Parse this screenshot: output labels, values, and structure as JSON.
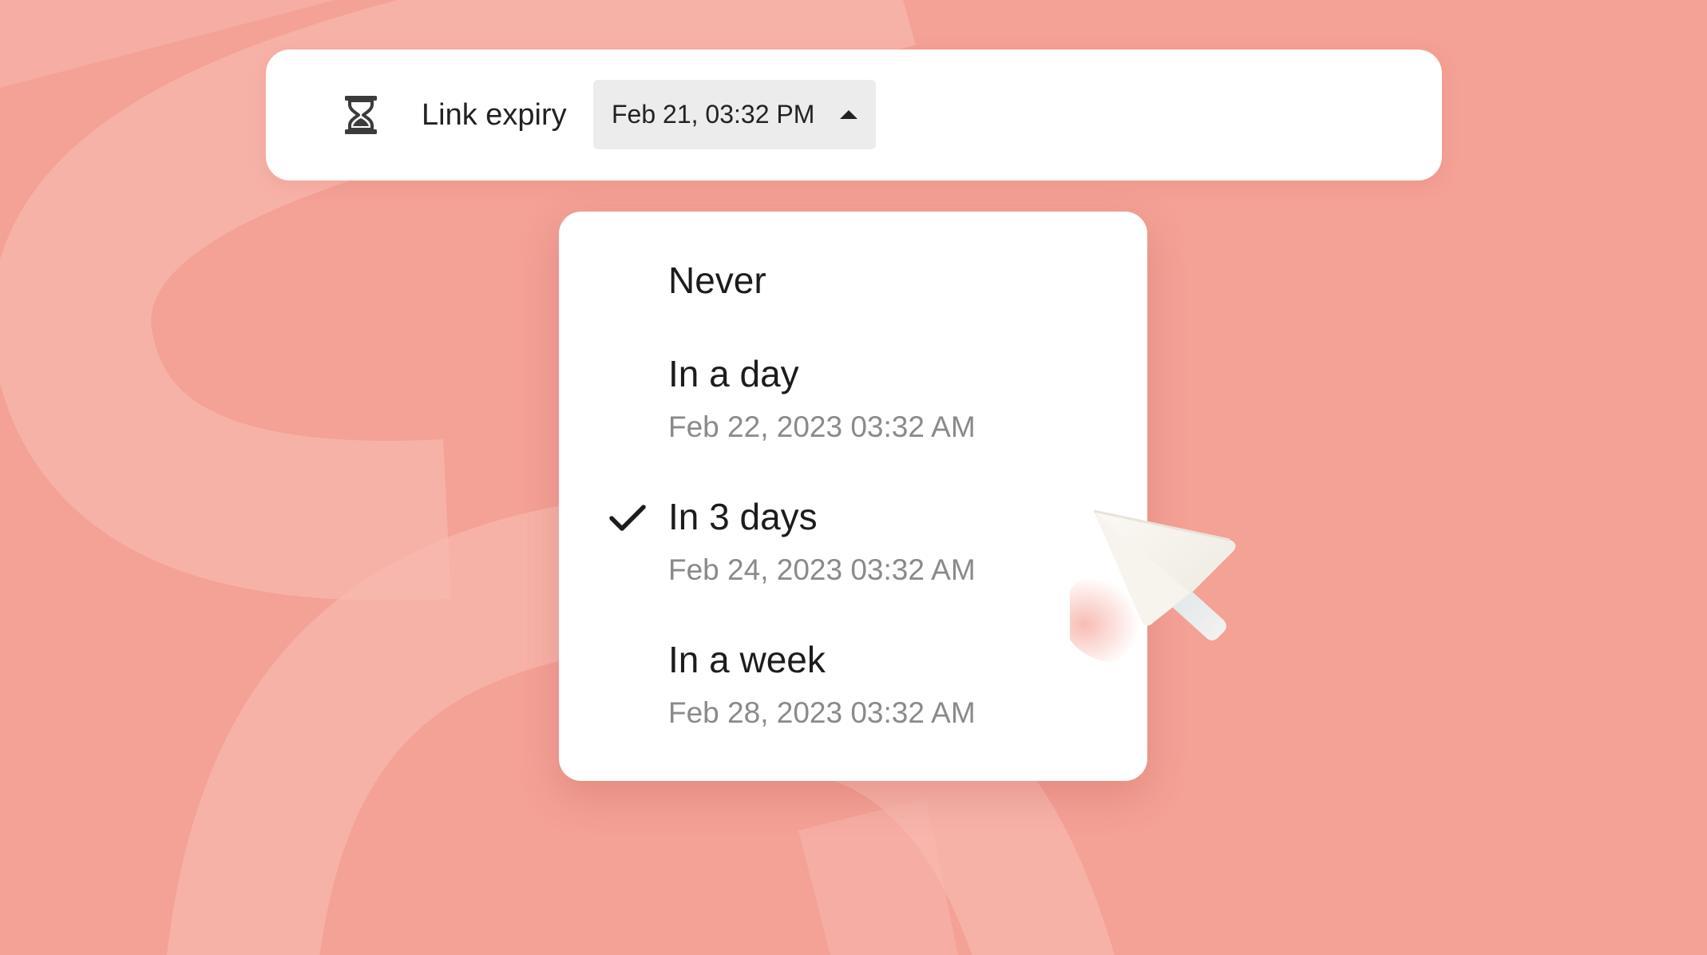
{
  "link_expiry": {
    "icon": "hourglass-icon",
    "label": "Link expiry",
    "selected_value": "Feb 21, 03:32 PM",
    "caret_icon": "caret-up-icon"
  },
  "menu": {
    "options": [
      {
        "label": "Never",
        "sublabel": "",
        "selected": false
      },
      {
        "label": "In a day",
        "sublabel": "Feb 22, 2023 03:32 AM",
        "selected": false
      },
      {
        "label": "In 3 days",
        "sublabel": "Feb 24, 2023 03:32 AM",
        "selected": true
      },
      {
        "label": "In a week",
        "sublabel": "Feb 28, 2023 03:32 AM",
        "selected": false
      }
    ]
  },
  "colors": {
    "background": "#f4a196",
    "background_shape": "#f8b7ad",
    "surface": "#ffffff",
    "select_fill": "#ececec",
    "text_primary": "#1c1c1c",
    "text_secondary": "#8a8a8a"
  }
}
